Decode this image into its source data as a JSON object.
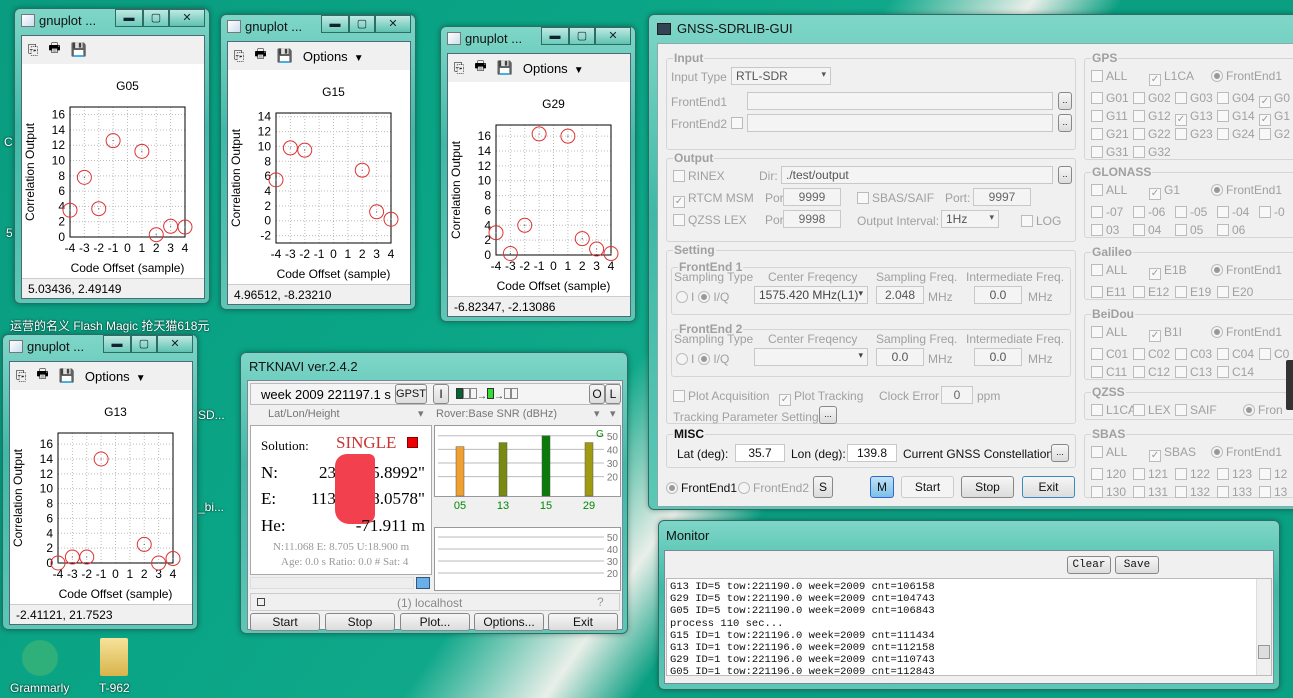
{
  "desktop": {
    "icon_row": "运营的名义   Flash Magic  抢天猫618元",
    "grammarly": "Grammarly",
    "folder": "T-962",
    "partial1": "SD...",
    "partial2": "_bi...",
    "partial3": "C",
    "partial4": "5"
  },
  "gnuplot_windows": [
    {
      "title": "gnuplot ...",
      "status": "5.03436,  2.49149",
      "options": "",
      "show_options": false
    },
    {
      "title": "gnuplot ...",
      "status": "4.96512, -8.23210",
      "options": "Options",
      "show_options": true
    },
    {
      "title": "gnuplot ...",
      "status": "-6.82347, -2.13086",
      "options": "Options",
      "show_options": true
    },
    {
      "title": "gnuplot ...",
      "status": "-2.41121,  21.7523",
      "options": "Options",
      "show_options": true
    }
  ],
  "chart_data": [
    {
      "type": "scatter",
      "title": "G05",
      "xlabel": "Code Offset (sample)",
      "ylabel": "Correlation Output",
      "xlim": [
        -4,
        4
      ],
      "ylim": [
        0,
        17
      ],
      "yticks": [
        0,
        2,
        4,
        6,
        8,
        10,
        12,
        14,
        16
      ],
      "xticks": [
        -4,
        -3,
        -2,
        -1,
        0,
        1,
        2,
        3,
        4
      ],
      "grid": true,
      "x": [
        -4,
        -3,
        -2,
        -1,
        1,
        2,
        3,
        4
      ],
      "y": [
        3.5,
        7.8,
        3.7,
        12.6,
        11.2,
        0.3,
        1.4,
        1.3
      ]
    },
    {
      "type": "scatter",
      "title": "G15",
      "xlabel": "Code Offset (sample)",
      "ylabel": "Correlation Output",
      "xlim": [
        -4,
        4
      ],
      "ylim": [
        -3,
        14.5
      ],
      "yticks": [
        -2,
        0,
        2,
        4,
        6,
        8,
        10,
        12,
        14
      ],
      "xticks": [
        -4,
        -3,
        -2,
        -1,
        0,
        1,
        2,
        3,
        4
      ],
      "grid": true,
      "x": [
        -4,
        -3,
        -2,
        2,
        3,
        4
      ],
      "y": [
        5.5,
        9.8,
        9.5,
        6.8,
        1.2,
        0.2
      ]
    },
    {
      "type": "scatter",
      "title": "G29",
      "xlabel": "Code Offset (sample)",
      "ylabel": "Correlation Output",
      "xlim": [
        -4,
        4
      ],
      "ylim": [
        0,
        17.5
      ],
      "yticks": [
        0,
        2,
        4,
        6,
        8,
        10,
        12,
        14,
        16
      ],
      "xticks": [
        -4,
        -3,
        -2,
        -1,
        0,
        1,
        2,
        3,
        4
      ],
      "grid": true,
      "x": [
        -4,
        -3,
        -2,
        -1,
        1,
        2,
        3,
        4
      ],
      "y": [
        3.0,
        0.2,
        4.0,
        16.3,
        16.0,
        2.2,
        0.8,
        0.2
      ]
    },
    {
      "type": "scatter",
      "title": "G13",
      "xlabel": "Code Offset (sample)",
      "ylabel": "Correlation Output",
      "xlim": [
        -4,
        4
      ],
      "ylim": [
        0,
        17.5
      ],
      "yticks": [
        0,
        2,
        4,
        6,
        8,
        10,
        12,
        14,
        16
      ],
      "xticks": [
        -4,
        -3,
        -2,
        -1,
        0,
        1,
        2,
        3,
        4
      ],
      "grid": true,
      "x": [
        -4,
        -3,
        -2,
        -1,
        2,
        3,
        4
      ],
      "y": [
        0,
        0.8,
        0.8,
        14,
        2.5,
        0,
        0.6
      ]
    },
    {
      "type": "bar",
      "title": "Rover:Base SNR (dBHz)",
      "categories": [
        "05",
        "13",
        "15",
        "29"
      ],
      "values": [
        42,
        45,
        50,
        45
      ],
      "colors": [
        "#f0a030",
        "#7a8a10",
        "#0a7a0a",
        "#a09a10"
      ],
      "ylim": [
        5,
        55
      ],
      "yticks": [
        20,
        30,
        40,
        50
      ],
      "system_label": "G"
    }
  ],
  "rtknavi": {
    "title": "RTKNAVI ver.2.4.2",
    "time": "week 2009 221197.1 s",
    "gpst": "GPST",
    "i": "I",
    "o": "O",
    "l": "L",
    "left_panel": "Lat/Lon/Height",
    "right_panel": "Rover:Base SNR (dBHz)",
    "solution_label": "Solution:",
    "solution": "SINGLE",
    "n_label": "N:",
    "n_val_a": "23°",
    "n_val_b": "5.8992\"",
    "e_label": "E:",
    "e_val_a": "113°",
    "e_val_b": "8.0578\"",
    "he_label": "He:",
    "he_val": "-71.911 m",
    "std": "N:11.068 E: 8.705 U:18.900 m",
    "age": "Age: 0.0 s Ratio: 0.0 # Sat: 4",
    "server": "(1) localhost",
    "buttons": {
      "start": "Start",
      "stop": "Stop",
      "plot": "Plot...",
      "options": "Options...",
      "exit": "Exit"
    }
  },
  "gui": {
    "title": "GNSS-SDRLIB-GUI",
    "input": {
      "label": "Input",
      "type_label": "Input Type",
      "type_value": "RTL-SDR",
      "fe1": "FrontEnd1",
      "fe2": "FrontEnd2",
      "browse": ".."
    },
    "output": {
      "label": "Output",
      "rinex": "RINEX",
      "dir_label": "Dir:",
      "dir": "./test/output",
      "rtcm": "RTCM MSM",
      "port": "Port:",
      "rtcm_port": "9999",
      "sbas": "SBAS/SAIF",
      "sbas_port": "9997",
      "qzss": "QZSS LEX",
      "qzss_port": "9998",
      "interval_label": "Output Interval:",
      "interval": "1Hz",
      "log": "LOG"
    },
    "setting": {
      "label": "Setting",
      "fe1": "FrontEnd 1",
      "fe2": "FrontEnd 2",
      "sampling_type": "Sampling Type",
      "center": "Center Freqency",
      "samp_freq": "Sampling Freq.",
      "if_freq": "Intermediate Freq.",
      "i": "I",
      "iq": "I/Q",
      "fe1_center": "1575.420 MHz(L1)",
      "fe1_samp": "2.048",
      "fe1_if": "0.0",
      "fe2_center": "",
      "fe2_samp": "0.0",
      "fe2_if": "0.0",
      "mhz": "MHz",
      "plot_acq": "Plot Acquisition",
      "plot_trk": "Plot Tracking",
      "clock_label": "Clock Error",
      "clock": "0",
      "ppm": "ppm",
      "trk_param": "Tracking Parameter Setting",
      "dots": "..."
    },
    "misc": {
      "label": "MISC",
      "lat_label": "Lat (deg):",
      "lat": "35.7",
      "lon_label": "Lon (deg):",
      "lon": "139.8",
      "constellation": "Current GNSS Constellation",
      "dots": "..."
    },
    "bottom": {
      "fe1": "FrontEnd1",
      "fe2": "FrontEnd2",
      "s": "S",
      "m": "M",
      "start": "Start",
      "stop": "Stop",
      "exit": "Exit"
    },
    "systems": [
      {
        "name": "GPS",
        "head": [
          {
            "l": "ALL",
            "c": false
          },
          {
            "l": "L1CA",
            "c": true
          }
        ],
        "fe": "FrontEnd1",
        "rows": [
          [
            [
              "G01",
              0
            ],
            [
              "G02",
              0
            ],
            [
              "G03",
              0
            ],
            [
              "G04",
              0
            ],
            [
              "G0",
              1
            ]
          ],
          [
            [
              "G11",
              0
            ],
            [
              "G12",
              0
            ],
            [
              "G13",
              1
            ],
            [
              "G14",
              0
            ],
            [
              "G1",
              1
            ]
          ],
          [
            [
              "G21",
              0
            ],
            [
              "G22",
              0
            ],
            [
              "G23",
              0
            ],
            [
              "G24",
              0
            ],
            [
              "G2",
              0
            ]
          ],
          [
            [
              "G31",
              0
            ],
            [
              "G32",
              0
            ]
          ]
        ]
      },
      {
        "name": "GLONASS",
        "head": [
          {
            "l": "ALL",
            "c": false
          },
          {
            "l": "G1",
            "c": true
          }
        ],
        "fe": "FrontEnd1",
        "rows": [
          [
            [
              "-07",
              0
            ],
            [
              "-06",
              0
            ],
            [
              "-05",
              0
            ],
            [
              "-04",
              0
            ],
            [
              "-0",
              0
            ]
          ],
          [
            [
              "03",
              0
            ],
            [
              "04",
              0
            ],
            [
              "05",
              0
            ],
            [
              "06",
              0
            ]
          ]
        ]
      },
      {
        "name": "Galileo",
        "head": [
          {
            "l": "ALL",
            "c": false
          },
          {
            "l": "E1B",
            "c": true
          }
        ],
        "fe": "FrontEnd1",
        "rows": [
          [
            [
              "E11",
              0
            ],
            [
              "E12",
              0
            ],
            [
              "E19",
              0
            ],
            [
              "E20",
              0
            ]
          ]
        ]
      },
      {
        "name": "BeiDou",
        "head": [
          {
            "l": "ALL",
            "c": false
          },
          {
            "l": "B1I",
            "c": true
          }
        ],
        "fe": "FrontEnd1",
        "rows": [
          [
            [
              "C01",
              0
            ],
            [
              "C02",
              0
            ],
            [
              "C03",
              0
            ],
            [
              "C04",
              0
            ],
            [
              "C0",
              0
            ]
          ],
          [
            [
              "C11",
              0
            ],
            [
              "C12",
              0
            ],
            [
              "C13",
              0
            ],
            [
              "C14",
              0
            ]
          ]
        ]
      },
      {
        "name": "QZSS",
        "head": [
          {
            "l": "L1CA",
            "c": false
          },
          {
            "l": "LEX",
            "c": false
          },
          {
            "l": "SAIF",
            "c": false
          }
        ],
        "fe": "Fron",
        "rows": []
      },
      {
        "name": "SBAS",
        "head": [
          {
            "l": "ALL",
            "c": false
          },
          {
            "l": "SBAS",
            "c": true
          }
        ],
        "fe": "FrontEnd1",
        "rows": [
          [
            [
              "120",
              0
            ],
            [
              "121",
              0
            ],
            [
              "122",
              0
            ],
            [
              "123",
              0
            ],
            [
              "12",
              0
            ]
          ],
          [
            [
              "130",
              0
            ],
            [
              "131",
              0
            ],
            [
              "132",
              0
            ],
            [
              "133",
              0
            ],
            [
              "13",
              0
            ]
          ]
        ]
      }
    ]
  },
  "monitor": {
    "title": "Monitor",
    "clear": "Clear",
    "save": "Save",
    "lines": [
      "G13 ID=5 tow:221190.0 week=2009 cnt=106158",
      "G29 ID=5 tow:221190.0 week=2009 cnt=104743",
      "G05 ID=5 tow:221190.0 week=2009 cnt=106843",
      "process 110 sec...",
      "G15 ID=1 tow:221196.0 week=2009 cnt=111434",
      "G13 ID=1 tow:221196.0 week=2009 cnt=112158",
      "G29 ID=1 tow:221196.0 week=2009 cnt=110743",
      "G05 ID=1 tow:221196.0 week=2009 cnt=112843"
    ]
  }
}
